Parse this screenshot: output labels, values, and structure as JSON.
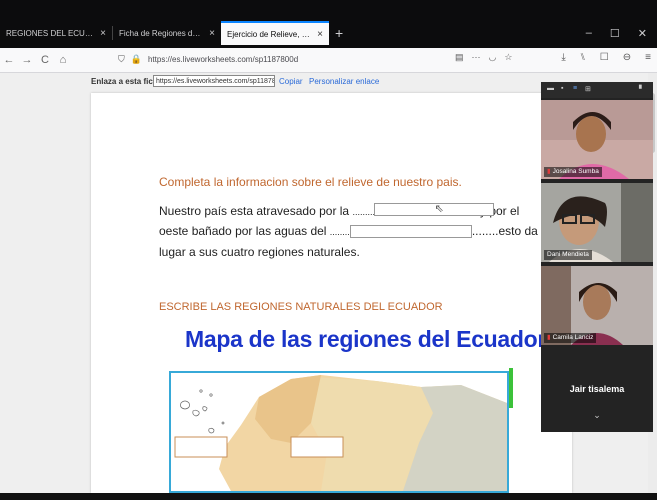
{
  "browser": {
    "tabs": [
      {
        "label": "REGIONES DEL ECUADOR fichas"
      },
      {
        "label": "Ficha de Regiones del Ecuador"
      },
      {
        "label": "Ejercicio de Relieve, regiones natu"
      }
    ],
    "tab_close": "×",
    "new_tab": "+",
    "window": {
      "minimize": "–",
      "maximize": "☐",
      "close": "✕"
    },
    "nav": {
      "back": "←",
      "forward": "→",
      "reload": "C",
      "home": "⌂"
    },
    "url": "https://es.liveworksheets.com/sp1187800d",
    "page_actions": "···",
    "toolbar_right": [
      "⤓",
      "⑊",
      "☐",
      "⊖",
      "≡"
    ]
  },
  "sharebar": {
    "label": "Enlaza a esta ficha:",
    "value": "https://es.liveworksheets.com/sp1187800d",
    "copy": "Copiar",
    "customize": "Personalizar enlace"
  },
  "worksheet": {
    "question1": "Completa la informacion sobre el relieve de nuestro pais.",
    "line1_a": "Nuestro país esta atravesado por la ",
    "line1_dots": "...............................................",
    "line1_b": "...y por el",
    "line2_a": "oeste bañado por las aguas del ",
    "line2_dots": "........",
    "line2_b": "........esto da",
    "line3": "lugar a sus cuatro regiones naturales.",
    "question2": "ESCRIBE LAS REGIONES NATURALES DEL ECUADOR",
    "map_title": "Mapa de las regiones del Ecuador"
  },
  "video_panel": {
    "participants": [
      {
        "name": "Josalina Sumba"
      },
      {
        "name": "Dani Mendieta"
      },
      {
        "name": "Camila Lanciz"
      }
    ],
    "speaker": "Jair tisalema",
    "chevron": "⌄"
  },
  "colors": {
    "question": "#c0672f",
    "title_blue": "#1b35c9",
    "map_border": "#37a9d8",
    "link": "#2a6ad8",
    "tab_accent": "#0a84ff"
  }
}
